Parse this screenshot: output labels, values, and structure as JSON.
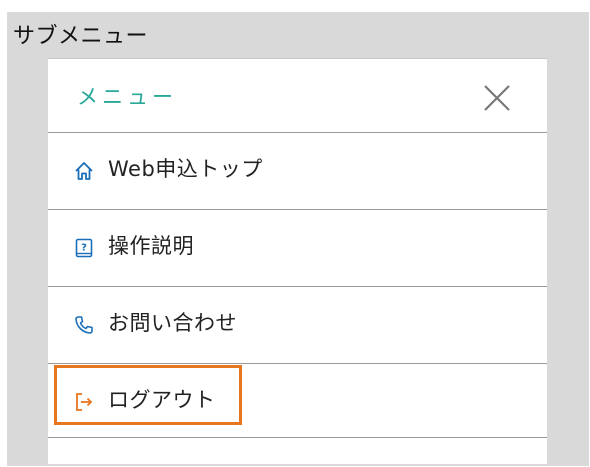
{
  "frame": {
    "title": "サブメニュー"
  },
  "menu": {
    "title": "メニュー",
    "close_icon": "close-icon",
    "items": [
      {
        "label": "Web申込トップ",
        "icon": "home-icon"
      },
      {
        "label": "操作説明",
        "icon": "help-book-icon"
      },
      {
        "label": "お問い合わせ",
        "icon": "phone-icon"
      },
      {
        "label": "ログアウト",
        "icon": "logout-icon",
        "highlighted": true
      }
    ]
  },
  "colors": {
    "accent": "#2aa99b",
    "highlight_border": "#e8761e",
    "frame_bg": "#d9d9d9"
  }
}
